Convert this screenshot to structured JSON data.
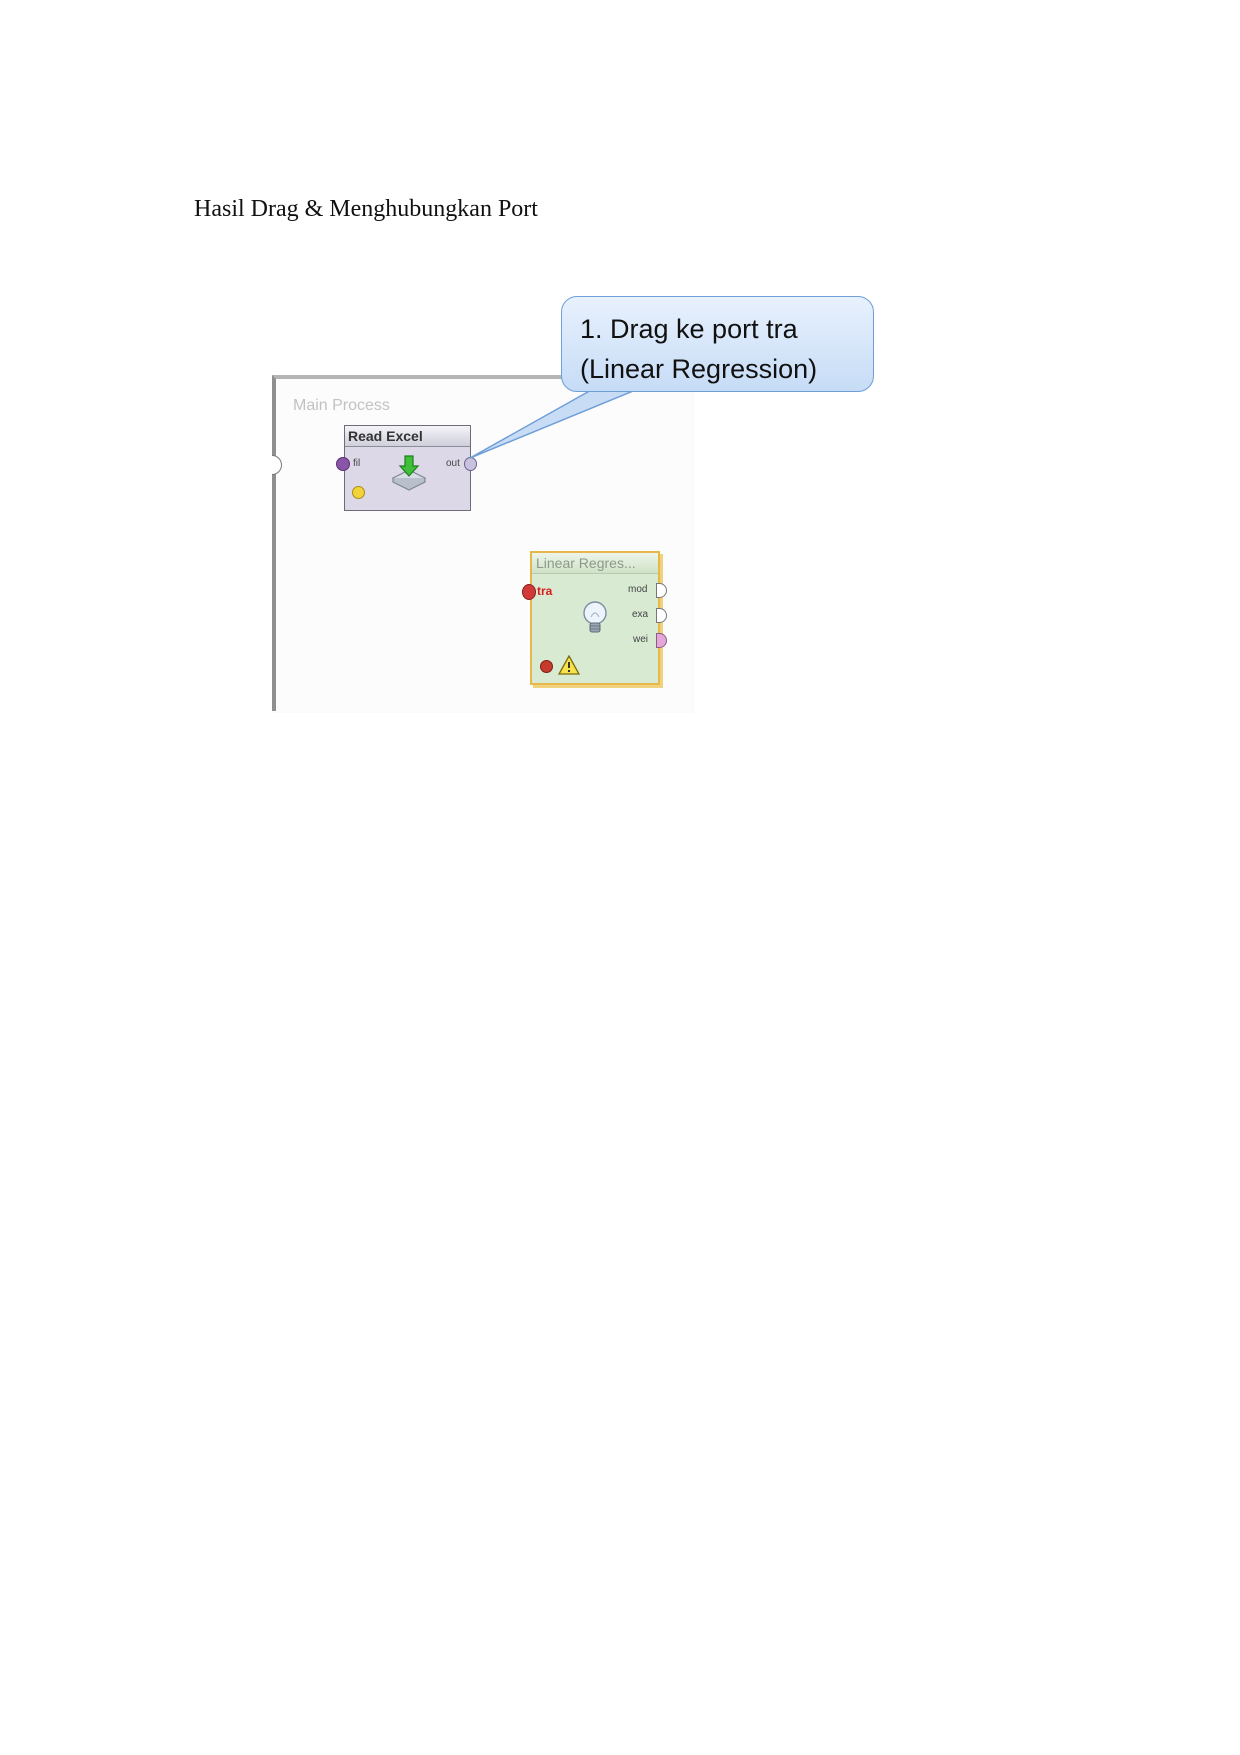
{
  "heading": "Hasil Drag & Menghubungkan Port",
  "process": {
    "title": "Main Process"
  },
  "read_excel": {
    "title": "Read Excel",
    "in_port": "fil",
    "out_port": "out"
  },
  "linear_regression": {
    "title": "Linear Regres...",
    "in_port": "tra",
    "out_ports": [
      "mod",
      "exa",
      "wei"
    ]
  },
  "callout": {
    "line1": "1. Drag ke port tra",
    "line2": "(Linear Regression)"
  },
  "colors": {
    "callout_border": "#6f9fd8",
    "linear_border": "#e6b84a",
    "tra_label": "#d81b1b"
  }
}
